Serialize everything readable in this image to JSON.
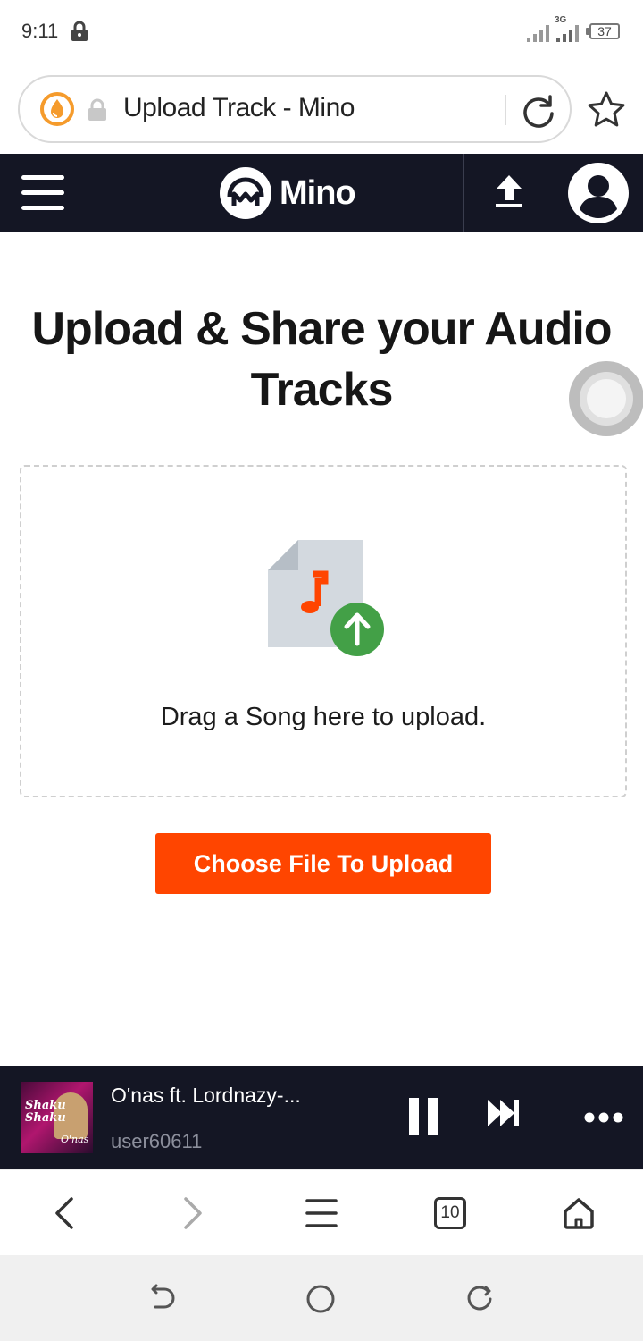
{
  "status_bar": {
    "time": "9:11",
    "network": "3G",
    "battery": "37"
  },
  "browser": {
    "url_text": "Upload Track - Mino"
  },
  "header": {
    "brand_name": "Mino"
  },
  "main": {
    "title": "Upload & Share your Audio Tracks",
    "drop_text": "Drag a Song here to upload.",
    "choose_button": "Choose File To Upload"
  },
  "player": {
    "track_title": "O'nas ft. Lordnazy-...",
    "track_user": "user60611",
    "album_art_title": "Shaku Shaku",
    "album_art_signature": "O'nas"
  },
  "browser_toolbar": {
    "tab_count": "10"
  },
  "colors": {
    "accent": "#ff4500",
    "header_bg": "#141624",
    "upload_badge": "#43a047",
    "music_note": "#ff4500"
  }
}
